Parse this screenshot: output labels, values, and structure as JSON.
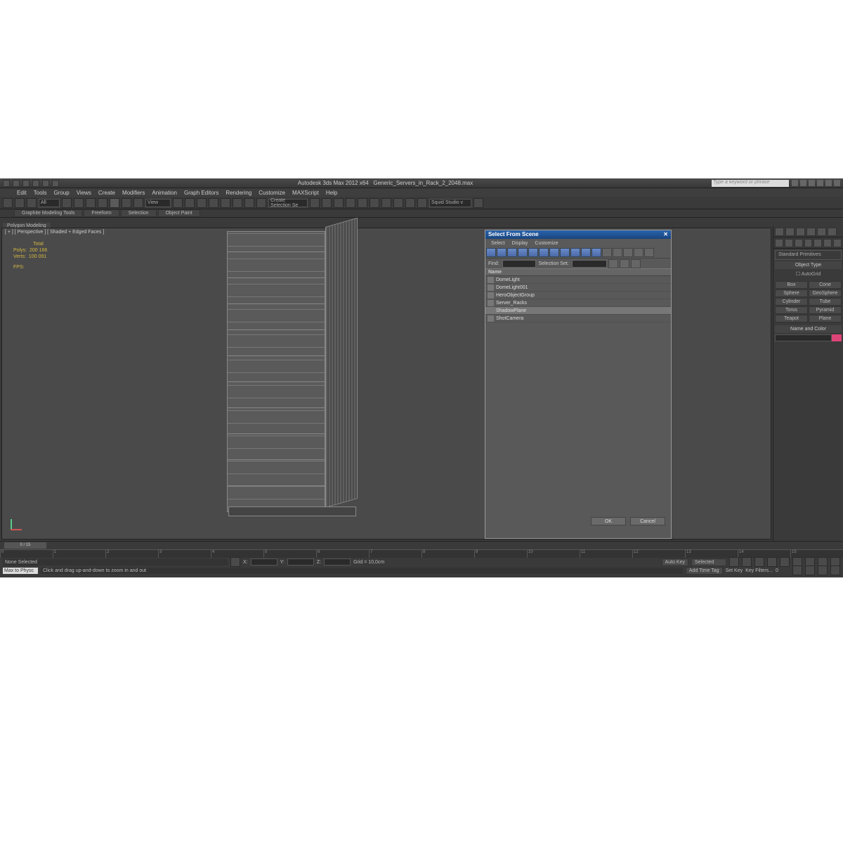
{
  "titlebar": {
    "app_title": "Autodesk 3ds Max 2012 x64",
    "file_name": "Generic_Servers_in_Rack_2_2048.max",
    "search_placeholder": "Type a keyword or phrase"
  },
  "menubar": [
    "Edit",
    "Tools",
    "Group",
    "Views",
    "Create",
    "Modifiers",
    "Animation",
    "Graph Editors",
    "Rendering",
    "Customize",
    "MAXScript",
    "Help"
  ],
  "toolbar": {
    "dropdown_all": "All",
    "dropdown_view": "View",
    "create_selection": "Create Selection Se",
    "named_set": "Squid Studio v"
  },
  "ribbon": {
    "tabs": [
      "Graphite Modeling Tools",
      "Freeform",
      "Selection",
      "Object Paint"
    ],
    "sub": "Polygon Modeling"
  },
  "viewport": {
    "label": "[ + ] [ Perspective ] [ Shaded + Edged Faces ]",
    "stats": {
      "title": "Total",
      "polys_lbl": "Polys:",
      "polys_val": "200 166",
      "verts_lbl": "Verts:",
      "verts_val": "100 091",
      "fps_lbl": "FPS:"
    }
  },
  "sfs": {
    "title": "Select From Scene",
    "menus": [
      "Select",
      "Display",
      "Customize"
    ],
    "find_lbl": "Find:",
    "selset_lbl": "Selection Set:",
    "col_header": "Name",
    "items": [
      "DomeLight",
      "DomeLight001",
      "HeroObjectGroup",
      "Server_Racks",
      "ShadowPlane",
      "ShotCamera"
    ],
    "selected_idx": 4,
    "ok": "OK",
    "cancel": "Cancel"
  },
  "cmdpanel": {
    "dropdown": "Standard Primitives",
    "object_type": "Object Type",
    "autogrid": "AutoGrid",
    "buttons": [
      "Box",
      "Cone",
      "Sphere",
      "GeoSphere",
      "Cylinder",
      "Tube",
      "Torus",
      "Pyramid",
      "Teapot",
      "Plane"
    ],
    "name_color": "Name and Color"
  },
  "timeline": {
    "slider": "0 / 15",
    "ticks": [
      "0",
      "1",
      "2",
      "3",
      "4",
      "5",
      "6",
      "7",
      "8",
      "9",
      "10",
      "11",
      "12",
      "13",
      "14",
      "15"
    ]
  },
  "status": {
    "selection": "None Selected",
    "x": "X:",
    "y": "Y:",
    "z": "Z:",
    "grid": "Grid = 10,0cm",
    "autokey": "Auto Key",
    "selected": "Selected",
    "max_physc": "Max to Physc",
    "prompt": "Click and drag up-and-down to zoom in and out",
    "add_time_tag": "Add Time Tag",
    "setkey": "Set Key",
    "keyfilters": "Key Filters..."
  }
}
